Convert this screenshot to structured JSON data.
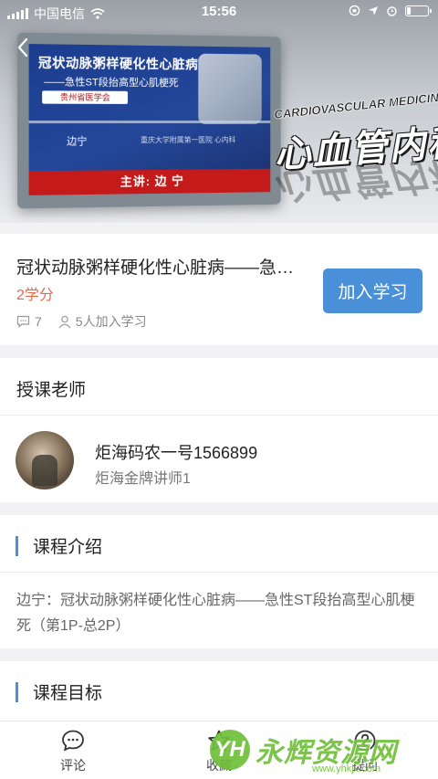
{
  "status_bar": {
    "carrier": "中国电信",
    "time": "15:56",
    "battery_level": 0.2
  },
  "hero": {
    "slide_title": "冠状动脉粥样硬化性心脏病",
    "slide_subtitle": "——急性ST段抬高型心肌梗死",
    "slide_logo": "贵州省医学会",
    "slide_speaker": "边宁",
    "slide_institution": "重庆大学附属第一医院 心内科",
    "slide_bar": "主讲: 边 宁",
    "brand_en": "CARDIOVASCULAR MEDICINE",
    "brand_cn": "心血管内科",
    "back_icon": "chevron-left-icon"
  },
  "course": {
    "title": "冠状动脉粥样硬化性心脏病——急性ST段抬高型心肌梗死",
    "credit": "2学分",
    "comments": "7",
    "learners": "5人加入学习",
    "join_label": "加入学习",
    "accent_color": "#4a90d9",
    "credit_color": "#e16a4f"
  },
  "teacher_section": {
    "heading": "授课老师",
    "name": "炬海码农一号1566899",
    "title": "炬海金牌讲师1"
  },
  "intro_section": {
    "heading": "课程介绍",
    "text": "边宁：冠状动脉粥样硬化性心脏病——急性ST段抬高型心肌梗死（第1P-总2P）"
  },
  "goal_section": {
    "heading": "课程目标"
  },
  "tabbar": {
    "comment_label": "评论",
    "favorite_label": "收藏",
    "ask_label": "提问"
  },
  "watermark": {
    "logo": "YH",
    "text": "永辉资源网",
    "url": "www.yhkjx.com"
  }
}
